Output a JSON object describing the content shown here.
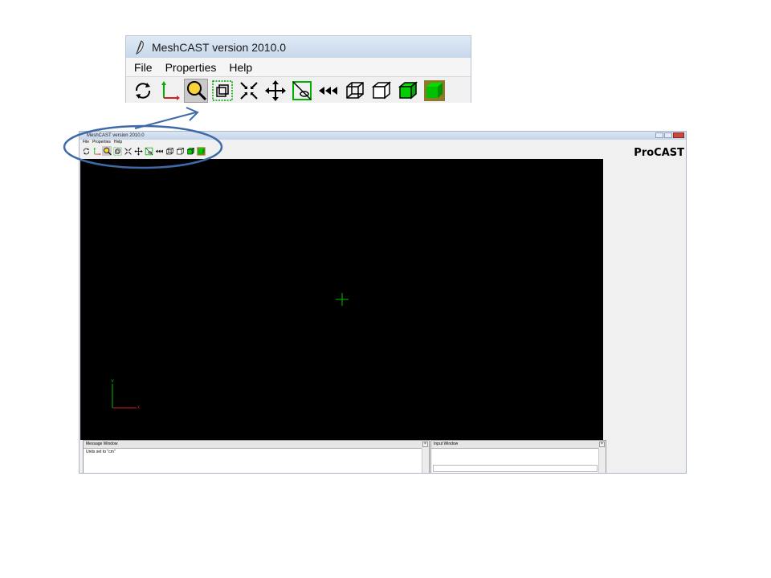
{
  "app_title": "MeshCAST version 2010.0",
  "menu": [
    "File",
    "Properties",
    "Help"
  ],
  "toolbar_icons": [
    {
      "name": "rotate-icon",
      "pressed": false
    },
    {
      "name": "axes-icon",
      "pressed": false
    },
    {
      "name": "zoom-icon",
      "pressed": true
    },
    {
      "name": "zoom-box-icon",
      "pressed": false
    },
    {
      "name": "zoom-fit-icon",
      "pressed": false
    },
    {
      "name": "pan-icon",
      "pressed": false
    },
    {
      "name": "cut-plane-icon",
      "pressed": false
    },
    {
      "name": "previous-view-icon",
      "pressed": false
    },
    {
      "name": "wireframe-icon",
      "pressed": false
    },
    {
      "name": "hidden-line-icon",
      "pressed": false
    },
    {
      "name": "shaded-icon",
      "pressed": false
    },
    {
      "name": "shaded-edges-icon",
      "pressed": false
    }
  ],
  "brand": "ProCAST",
  "axis_labels": {
    "x": "x",
    "y": "Y"
  },
  "message_window": {
    "title": "Message Window",
    "text": "Units set to \"cm\""
  },
  "input_window": {
    "title": "Input Window"
  },
  "close_glyph": "×",
  "colors": {
    "viewport": "#000000",
    "accent_green": "#00c000",
    "callout": "#3f6aa8"
  }
}
